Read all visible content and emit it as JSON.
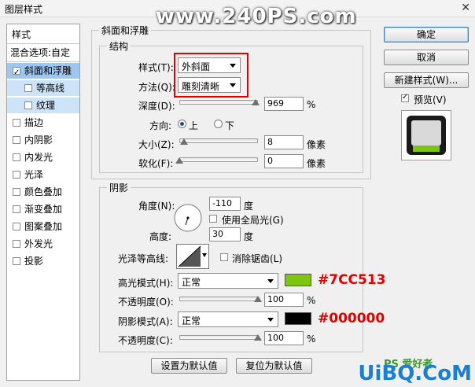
{
  "window": {
    "title": "图层样式",
    "close_glyph": "✕",
    "watermark": "www.240PS.com"
  },
  "left_panel": {
    "header": "样式",
    "blend_options": "混合选项:自定",
    "items": [
      {
        "label": "斜面和浮雕",
        "checked": true
      },
      {
        "label": "等高线",
        "checked": false
      },
      {
        "label": "纹理",
        "checked": false
      },
      {
        "label": "描边",
        "checked": false
      },
      {
        "label": "内阴影",
        "checked": false
      },
      {
        "label": "内发光",
        "checked": false
      },
      {
        "label": "光泽",
        "checked": false
      },
      {
        "label": "颜色叠加",
        "checked": false
      },
      {
        "label": "渐变叠加",
        "checked": false
      },
      {
        "label": "图案叠加",
        "checked": false
      },
      {
        "label": "外发光",
        "checked": false
      },
      {
        "label": "投影",
        "checked": false
      }
    ]
  },
  "bevel": {
    "section_title": "斜面和浮雕",
    "structure_title": "结构",
    "style_label": "样式(T):",
    "style_value": "外斜面",
    "technique_label": "方法(Q):",
    "technique_value": "雕刻清晰",
    "depth_label": "深度(D):",
    "depth_value": "969",
    "depth_unit": "%",
    "direction_label": "方向:",
    "direction_up": "上",
    "direction_down": "下",
    "size_label": "大小(Z):",
    "size_value": "8",
    "size_unit": "像素",
    "soften_label": "软化(F):",
    "soften_value": "0",
    "soften_unit": "像素"
  },
  "shading": {
    "title": "阴影",
    "angle_label": "角度(N):",
    "angle_value": "-110",
    "angle_unit": "度",
    "global_light_label": "使用全局光(G)",
    "altitude_label": "高度:",
    "altitude_value": "30",
    "altitude_unit": "度",
    "gloss_contour_label": "光泽等高线:",
    "antialias_label": "消除锯齿(L)",
    "highlight_mode_label": "高光模式(H):",
    "highlight_mode_value": "正常",
    "highlight_color": "#7CC513",
    "highlight_annotation": "#7CC513",
    "highlight_opacity_label": "不透明度(O):",
    "highlight_opacity_value": "100",
    "highlight_opacity_unit": "%",
    "shadow_mode_label": "阴影模式(A):",
    "shadow_mode_value": "正常",
    "shadow_color": "#000000",
    "shadow_annotation": "#000000",
    "shadow_opacity_label": "不透明度(C):",
    "shadow_opacity_value": "100",
    "shadow_opacity_unit": "%"
  },
  "bottom_buttons": {
    "set_default": "设置为默认值",
    "reset_default": "复位为默认值"
  },
  "right_panel": {
    "ok": "确定",
    "cancel": "取消",
    "new_style": "新建样式(W)...",
    "preview_label": "预览(V)",
    "preview_checked": true
  },
  "branding": {
    "logo": "UiBQ.CoM",
    "logo_small": "PS 爱好者"
  },
  "levels": {
    "depth_fraction": 0.97,
    "size_fraction": 0.06,
    "soften_fraction": 0.0,
    "highlight_opacity": 1.0,
    "shadow_opacity": 1.0
  }
}
